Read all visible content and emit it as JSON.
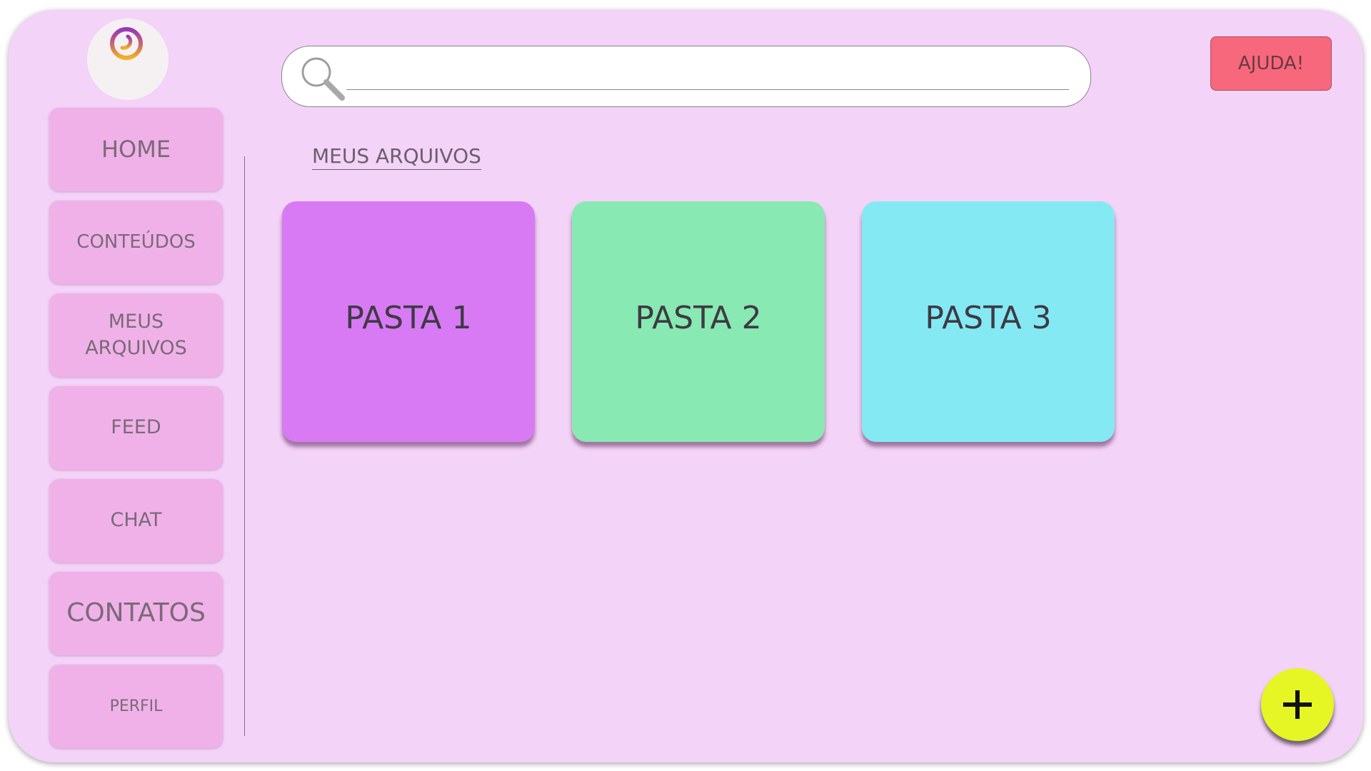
{
  "search": {
    "placeholder": "",
    "value": ""
  },
  "header": {
    "help_label": "AJUDA!"
  },
  "sidebar": {
    "logo_icon": "venus-symbol-icon",
    "items": [
      {
        "label": "HOME"
      },
      {
        "label": "CONTEÚDOS"
      },
      {
        "label": "MEUS ARQUIVOS"
      },
      {
        "label": "FEED"
      },
      {
        "label": "CHAT"
      },
      {
        "label": "CONTATOS"
      },
      {
        "label": "PERFIL"
      }
    ]
  },
  "main": {
    "section_title": "MEUS ARQUIVOS",
    "folders": [
      {
        "label": "PASTA 1",
        "color": "#d87af4"
      },
      {
        "label": "PASTA 2",
        "color": "#88e9b2"
      },
      {
        "label": "PASTA 3",
        "color": "#84e9f3"
      }
    ]
  },
  "fab": {
    "icon": "plus-icon"
  },
  "colors": {
    "background": "#f4d3f8",
    "nav_item": "#f0b1e8",
    "help_button": "#f7687c",
    "fab": "#e6f524"
  }
}
